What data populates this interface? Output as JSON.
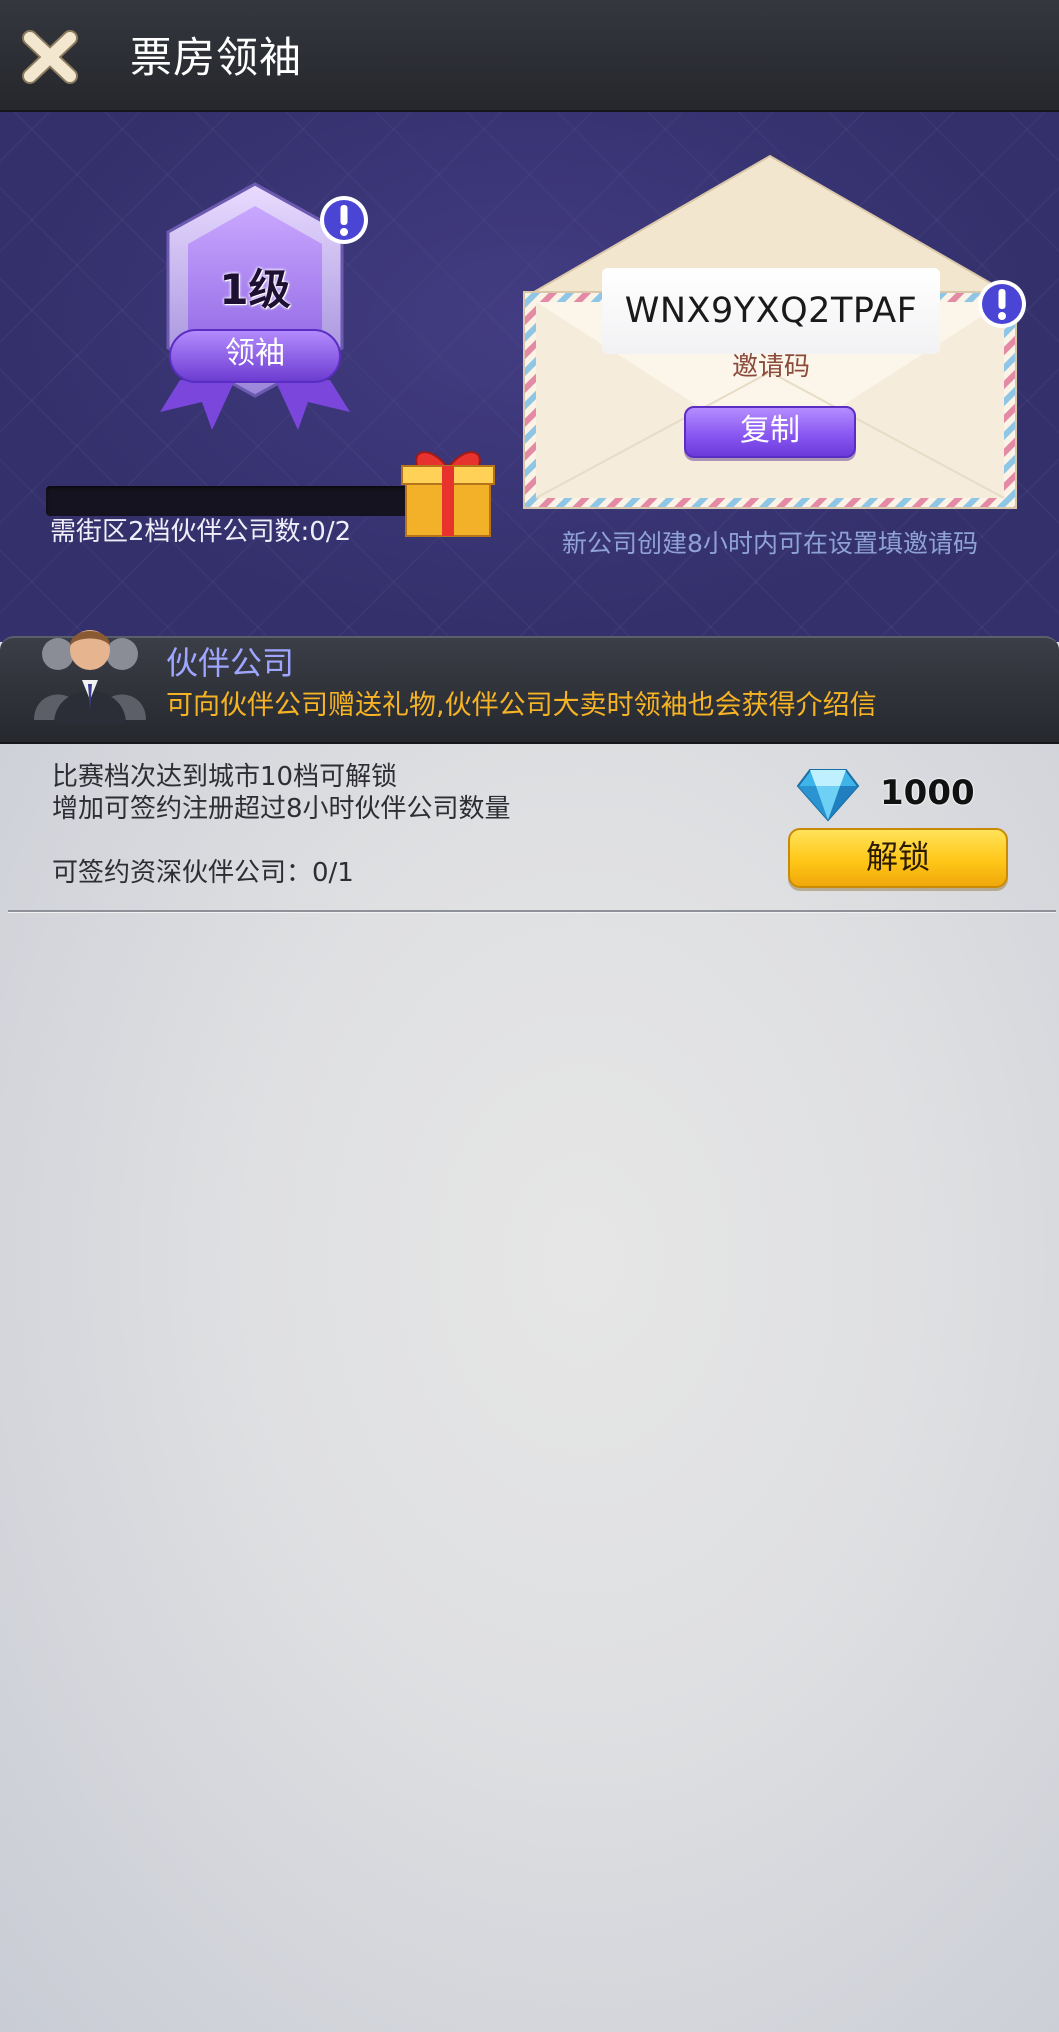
{
  "header": {
    "title": "票房领袖"
  },
  "leader": {
    "level": "1级",
    "rank_name": "领袖",
    "progress_text": "需街区2档伙伴公司数:0/2",
    "progress": 0
  },
  "invite": {
    "code": "WNX9YXQ2TPAF",
    "label": "邀请码",
    "copy_label": "复制",
    "hint": "新公司创建8小时内可在设置填邀请码"
  },
  "partner": {
    "title": "伙伴公司",
    "description": "可向伙伴公司赠送礼物,伙伴公司大卖时领袖也会获得介绍信"
  },
  "unlock": {
    "line1": "比赛档次达到城市10档可解锁",
    "line2": "增加可签约注册超过8小时伙伴公司数量",
    "line3": "可签约资深伙伴公司：0/1",
    "cost": "1000",
    "button_label": "解锁"
  },
  "icons": {
    "close": "close-icon",
    "info": "info-icon",
    "gift": "gift-icon",
    "gem": "diamond-icon",
    "avatar": "partner-people-icon"
  },
  "colors": {
    "accent_purple": "#8654f0",
    "accent_yellow": "#ffc718",
    "partner_title": "#9ea6ff",
    "partner_desc": "#f6b323"
  }
}
